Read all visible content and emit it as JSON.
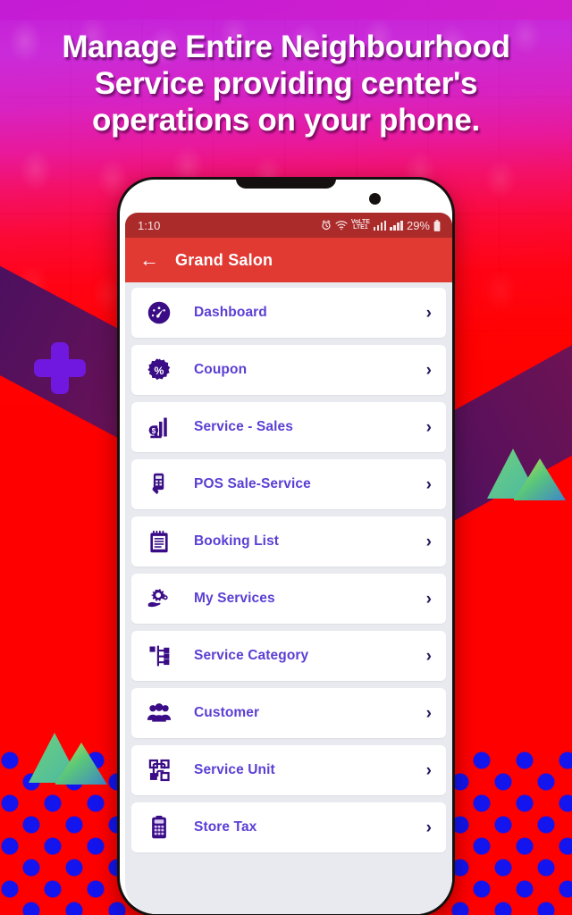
{
  "headline": "Manage Entire Neighbourhood Service providing center's operations on your phone.",
  "phone": {
    "status_bar": {
      "time": "1:10",
      "alarm_icon": "alarm-clock-icon",
      "wifi_icon": "wifi-icon",
      "network_label_top": "VoLTE",
      "network_label_bottom": "LTE1",
      "battery_percent": "29%",
      "battery_icon": "battery-icon"
    },
    "app_bar": {
      "back_icon": "back-arrow-icon",
      "title": "Grand Salon"
    },
    "menu": [
      {
        "label": "Dashboard",
        "icon": "dashboard-gauge-icon",
        "chevron": "›"
      },
      {
        "label": "Coupon",
        "icon": "coupon-percent-icon",
        "chevron": "›"
      },
      {
        "label": "Service - Sales",
        "icon": "sales-bar-chart-icon",
        "chevron": "›"
      },
      {
        "label": "POS Sale-Service",
        "icon": "pos-terminal-icon",
        "chevron": "›"
      },
      {
        "label": "Booking List",
        "icon": "notepad-icon",
        "chevron": "›"
      },
      {
        "label": "My Services",
        "icon": "hand-gear-icon",
        "chevron": "›"
      },
      {
        "label": "Service Category",
        "icon": "hierarchy-icon",
        "chevron": "›"
      },
      {
        "label": "Customer",
        "icon": "people-group-icon",
        "chevron": "›"
      },
      {
        "label": "Service Unit",
        "icon": "network-nodes-icon",
        "chevron": "›"
      },
      {
        "label": "Store Tax",
        "icon": "calculator-icon",
        "chevron": "›"
      }
    ]
  },
  "decorations": {
    "plus_icon": "plus-shape",
    "triangles_icon": "triangle-pair-shape",
    "dots_icon": "polka-dot-pattern"
  },
  "colors": {
    "accent_red": "#ff0000",
    "app_bar_red": "#e03a33",
    "status_bar_red": "#ab2b2b",
    "label_purple": "#5b3fd4",
    "icon_purple": "#3a0d87",
    "band_purple": "#2e0a52",
    "dot_blue": "#1414ee",
    "magenta": "#c21ad6",
    "list_bg": "#e8eaf0"
  }
}
